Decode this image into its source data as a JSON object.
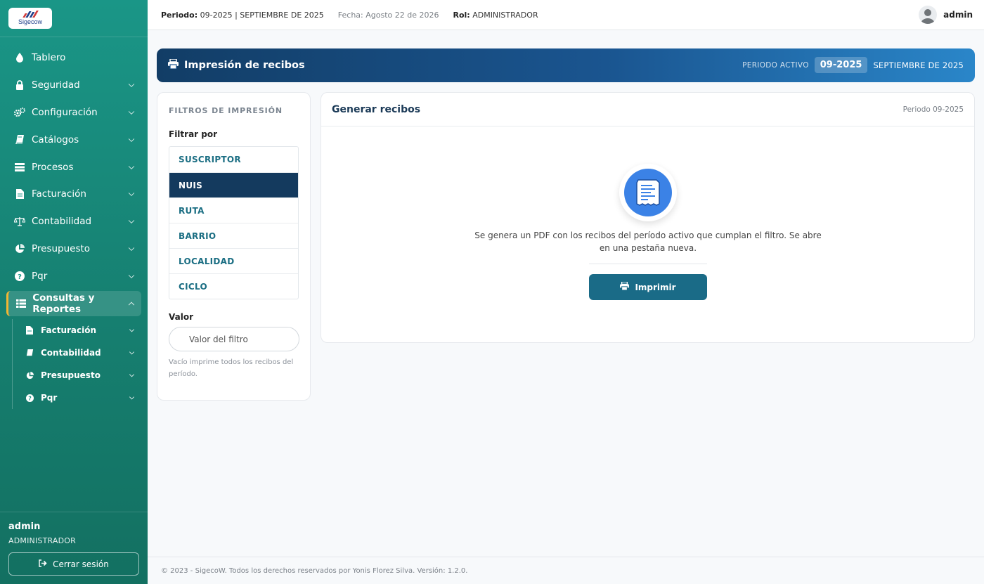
{
  "app": {
    "logo_text": "Sigecow"
  },
  "sidebar": {
    "items": [
      {
        "label": "Tablero",
        "icon": "droplet-icon"
      },
      {
        "label": "Seguridad",
        "icon": "lock-icon"
      },
      {
        "label": "Configuración",
        "icon": "gears-icon"
      },
      {
        "label": "Catálogos",
        "icon": "book-icon"
      },
      {
        "label": "Procesos",
        "icon": "list-icon"
      },
      {
        "label": "Facturación",
        "icon": "file-icon"
      },
      {
        "label": "Contabilidad",
        "icon": "scale-icon"
      },
      {
        "label": "Presupuesto",
        "icon": "pie-chart-icon"
      },
      {
        "label": "Pqr",
        "icon": "question-icon"
      },
      {
        "label": "Consultas y Reportes",
        "icon": "table-icon"
      }
    ],
    "subitems": [
      {
        "label": "Facturación",
        "icon": "file-icon"
      },
      {
        "label": "Contabilidad",
        "icon": "book-icon"
      },
      {
        "label": "Presupuesto",
        "icon": "pie-chart-icon"
      },
      {
        "label": "Pqr",
        "icon": "question-icon"
      }
    ],
    "footer": {
      "user": "admin",
      "role": "ADMINISTRADOR",
      "logout_label": "Cerrar sesión"
    }
  },
  "topbar": {
    "periodo_label": "Periodo:",
    "periodo_value": "09-2025 | SEPTIEMBRE DE 2025",
    "fecha": "Fecha: Agosto 22 de 2026",
    "rol_label": "Rol:",
    "rol_value": "ADMINISTRADOR",
    "user": "admin"
  },
  "banner": {
    "title": "Impresión de recibos",
    "periodo_label": "PERIODO ACTIVO",
    "periodo_code": "09-2025",
    "periodo_month": "SEPTIEMBRE DE 2025"
  },
  "filters": {
    "title": "FILTROS DE IMPRESIÓN",
    "filter_by_label": "Filtrar por",
    "options": [
      "SUSCRIPTOR",
      "NUIS",
      "RUTA",
      "BARRIO",
      "LOCALIDAD",
      "CICLO"
    ],
    "selected": "NUIS",
    "value_label": "Valor",
    "value_placeholder": "Valor del filtro",
    "hint": "Vacío imprime todos los recibos del período."
  },
  "main": {
    "title": "Generar recibos",
    "period": "Periodo 09-2025",
    "description": "Se genera un PDF con los recibos del período activo que cumplan el filtro. Se abre en una pestaña nueva.",
    "print_label": "Imprimir"
  },
  "footer": {
    "text": "© 2023 - SigecoW. Todos los derechos reservados por Yonis Florez Silva. Versión: 1.2.0."
  },
  "colors": {
    "sidebar": "#1a9687",
    "banner_start": "#123d66",
    "banner_end": "#2a86c9",
    "selected_option": "#143a5e",
    "print_button": "#1a6b87",
    "accent": "#f2b632",
    "doc_circle": "#3b82e6"
  }
}
